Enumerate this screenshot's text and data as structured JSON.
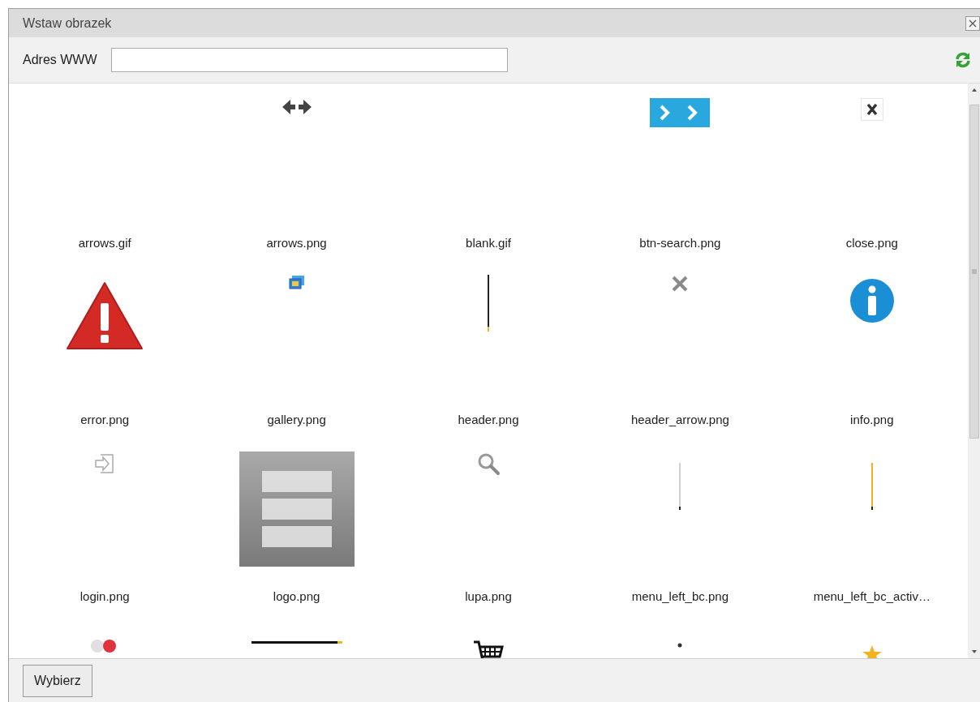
{
  "dialog": {
    "title": "Wstaw obrazek"
  },
  "url_field": {
    "label": "Adres WWW"
  },
  "files": [
    {
      "name": "arrows.gif",
      "kind": "empty"
    },
    {
      "name": "arrows.png",
      "kind": "double-arrow"
    },
    {
      "name": "blank.gif",
      "kind": "empty"
    },
    {
      "name": "btn-search.png",
      "kind": "chevrons"
    },
    {
      "name": "close.png",
      "kind": "x-small"
    },
    {
      "name": "error.png",
      "kind": "warning"
    },
    {
      "name": "gallery.png",
      "kind": "gallery"
    },
    {
      "name": "header.png",
      "kind": "dark-line"
    },
    {
      "name": "header_arrow.png",
      "kind": "grey-x"
    },
    {
      "name": "info.png",
      "kind": "info"
    },
    {
      "name": "login.png",
      "kind": "login"
    },
    {
      "name": "logo.png",
      "kind": "picture"
    },
    {
      "name": "lupa.png",
      "kind": "magnifier"
    },
    {
      "name": "menu_left_bc.png",
      "kind": "grey-line"
    },
    {
      "name": "menu_left_bc_activ…",
      "kind": "yellow-line"
    },
    {
      "kind": "toggle"
    },
    {
      "kind": "rule"
    },
    {
      "kind": "cart"
    },
    {
      "kind": "dot"
    },
    {
      "kind": "star"
    }
  ],
  "footer": {
    "button": "Wybierz"
  }
}
